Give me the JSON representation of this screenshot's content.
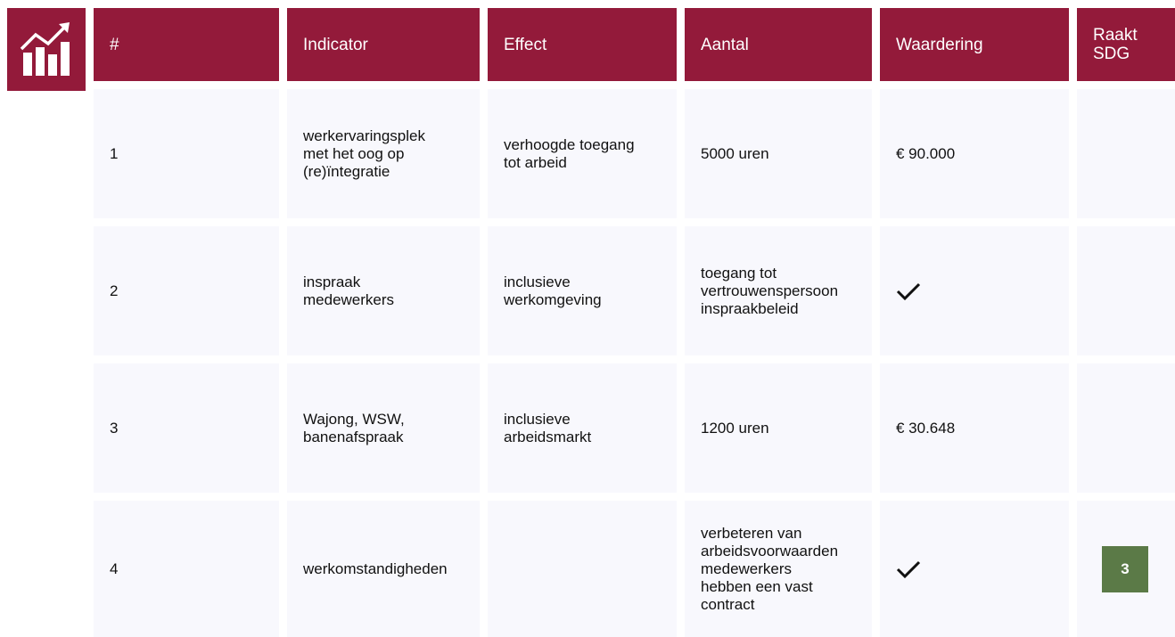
{
  "header": {
    "logo_icon": "growth-chart-icon",
    "columns": [
      "#",
      "Indicator",
      "Effect",
      "Aantal",
      "Waardering",
      "Raakt\nSDG"
    ]
  },
  "rows": [
    {
      "num": "1",
      "indicator": "werkervaringsplek\nmet het oog op\n(re)ïntegratie",
      "effect": "verhoogde toegang\ntot arbeid",
      "aantal": "5000 uren",
      "waardering": "€ 90.000",
      "waardering_check": false,
      "sdg": ""
    },
    {
      "num": "2",
      "indicator": "inspraak\nmedewerkers",
      "effect": "inclusieve\nwerkomgeving",
      "aantal": "toegang tot\nvertrouwenspersoon\ninspraakbeleid",
      "waardering": "",
      "waardering_check": true,
      "sdg": ""
    },
    {
      "num": "3",
      "indicator": "Wajong, WSW,\nbanenafspraak",
      "effect": "inclusieve\narbeidsmarkt",
      "aantal": "1200 uren",
      "waardering": "€ 30.648",
      "waardering_check": false,
      "sdg": ""
    },
    {
      "num": "4",
      "indicator": "werkomstandigheden",
      "effect": "",
      "aantal": "verbeteren van\narbeidsvoorwaarden\nmedewerkers\nhebben een vast\ncontract",
      "waardering": "",
      "waardering_check": true,
      "sdg": "3"
    }
  ],
  "colors": {
    "header_bg": "#931a3a",
    "cell_bg": "#f8f8fd",
    "sdg_badge": "#5b7a47"
  }
}
